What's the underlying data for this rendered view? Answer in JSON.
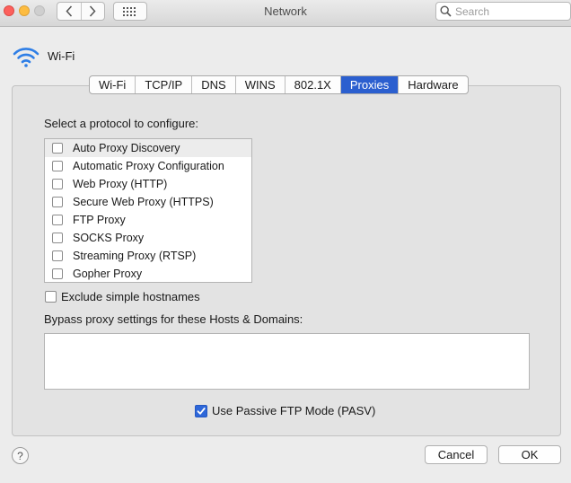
{
  "window": {
    "title": "Network",
    "search_placeholder": "Search"
  },
  "interface": {
    "name": "Wi-Fi",
    "icon": "wifi-icon"
  },
  "tabs": [
    {
      "label": "Wi-Fi",
      "active": false
    },
    {
      "label": "TCP/IP",
      "active": false
    },
    {
      "label": "DNS",
      "active": false
    },
    {
      "label": "WINS",
      "active": false
    },
    {
      "label": "802.1X",
      "active": false
    },
    {
      "label": "Proxies",
      "active": true
    },
    {
      "label": "Hardware",
      "active": false
    }
  ],
  "proxies": {
    "select_label": "Select a protocol to configure:",
    "protocols": [
      {
        "label": "Auto Proxy Discovery",
        "checked": false
      },
      {
        "label": "Automatic Proxy Configuration",
        "checked": false
      },
      {
        "label": "Web Proxy (HTTP)",
        "checked": false
      },
      {
        "label": "Secure Web Proxy (HTTPS)",
        "checked": false
      },
      {
        "label": "FTP Proxy",
        "checked": false
      },
      {
        "label": "SOCKS Proxy",
        "checked": false
      },
      {
        "label": "Streaming Proxy (RTSP)",
        "checked": false
      },
      {
        "label": "Gopher Proxy",
        "checked": false
      }
    ],
    "exclude_label": "Exclude simple hostnames",
    "exclude_checked": false,
    "bypass_label": "Bypass proxy settings for these Hosts & Domains:",
    "bypass_value": "",
    "pasv_label": "Use Passive FTP Mode (PASV)",
    "pasv_checked": true
  },
  "footer": {
    "help_label": "?",
    "cancel_label": "Cancel",
    "ok_label": "OK"
  },
  "colors": {
    "accent": "#2b5fcf",
    "close": "#fc605c",
    "minimize": "#fdbc40"
  }
}
